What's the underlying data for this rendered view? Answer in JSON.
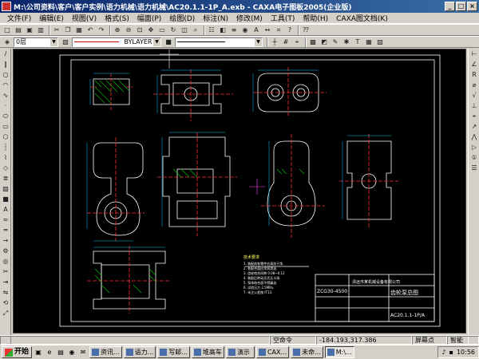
{
  "window": {
    "title": "M:\\公司资料\\客户\\客户实例\\语力机械\\语力机械\\AC20.1.1-1P_A.exb - CAXA电子图板2005(企业版)"
  },
  "menu": {
    "items": [
      "文件(F)",
      "编辑(E)",
      "视图(V)",
      "格式(S)",
      "幅面(P)",
      "绘图(D)",
      "标注(N)",
      "修改(M)",
      "工具(T)",
      "帮助(H)",
      "CAXA图文档(K)"
    ]
  },
  "toolbar": {
    "layer_value": "0层",
    "linetype_value": "BYLAYER",
    "color_value": ""
  },
  "canvas": {
    "title_block": {
      "drawing_no": "AC20.1.1-1P/A",
      "part_name": "齿轮泵总图",
      "company": "清远市某机械设备有限公司",
      "code_label": "ZCG30-4500"
    },
    "notes_title": "技术要求",
    "notes": [
      "1. 装配前各零件应清洗干净,",
      "2. 各配合面应涂润滑油.",
      "3. 齿轮啮合间隙 0.08~0.12",
      "4. 装配后转动灵活无卡滞.",
      "5. 泵体结合面不得漏油.",
      "6. 试验压力 2.5MPa.",
      "7. 未注公差按 IT13."
    ]
  },
  "statusbar": {
    "mode": "空命令",
    "coords": "-184.193,317.386",
    "snap": "屏幕点",
    "snap_select": "智能"
  },
  "taskbar": {
    "start": "开始",
    "tasks": [
      "资讯...",
      "语力...",
      "写邮...",
      "堆高车",
      "演示",
      "CAX...",
      "未命...",
      "M:\\..."
    ],
    "active_index": 7,
    "clock": "10:56"
  },
  "colors": {
    "canvas_bg": "#000000",
    "outline": "#ffffff",
    "hatch": "#00d000",
    "center": "#ff3030",
    "dimension": "#00c8ff",
    "titlebar": "#0a246a"
  }
}
